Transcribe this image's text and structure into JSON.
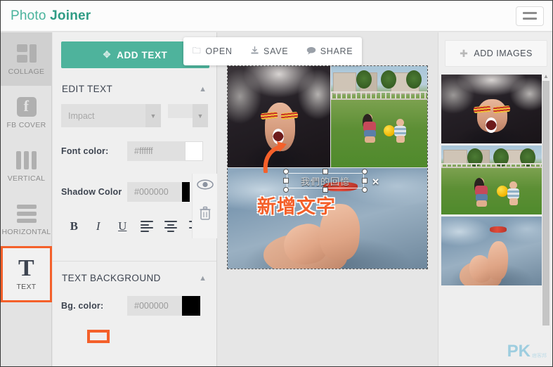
{
  "header": {
    "brand_light": "Photo ",
    "brand_bold": "Joiner",
    "menu_icon": "hamburger-icon"
  },
  "rail": {
    "items": [
      {
        "label": "COLLAGE",
        "icon": "collage-icon"
      },
      {
        "label": "FB COVER",
        "icon": "facebook-icon"
      },
      {
        "label": "VERTICAL",
        "icon": "vertical-columns-icon"
      },
      {
        "label": "HORIZONTAL",
        "icon": "horizontal-rows-icon"
      },
      {
        "label": "TEXT",
        "icon": "text-t-icon"
      }
    ]
  },
  "panel": {
    "add_text_button": "ADD TEXT",
    "add_text_icon": "move-arrows-icon",
    "edit_text": {
      "title": "EDIT TEXT",
      "collapse_icon": "caret-up-icon",
      "font_family_value": "Impact",
      "font_size_value": "",
      "font_color_label": "Font color:",
      "font_color_value": "#ffffff",
      "font_color_swatch": "#ffffff",
      "shadow_color_label": "Shadow Color",
      "shadow_color_value": "#000000",
      "shadow_color_swatch": "#000000",
      "format_buttons": [
        {
          "label": "B",
          "name": "bold-button"
        },
        {
          "label": "I",
          "name": "italic-button"
        },
        {
          "label": "U",
          "name": "underline-button"
        }
      ],
      "align_buttons": [
        {
          "name": "align-left-button"
        },
        {
          "name": "align-center-button"
        },
        {
          "name": "align-right-button"
        }
      ]
    },
    "text_background": {
      "title": "TEXT BACKGROUND",
      "collapse_icon": "caret-up-icon",
      "bg_color_label": "Bg. color:",
      "bg_color_value": "#000000",
      "bg_color_swatch": "#000000"
    },
    "tools": {
      "visibility_icon": "eye-icon",
      "delete_icon": "trash-icon"
    }
  },
  "float_menu": {
    "items": [
      {
        "label": "OPEN",
        "icon": "folder-icon"
      },
      {
        "label": "SAVE",
        "icon": "download-icon"
      },
      {
        "label": "SHARE",
        "icon": "speech-bubble-icon"
      }
    ]
  },
  "canvas": {
    "text_object_value": "我們的回憶",
    "text_delete_icon": "close-x-icon",
    "annotation_caption": "新增文字",
    "annotation_arrow_icon": "curved-arrow-icon",
    "carousel_next_icon": "chevron-right-icon",
    "photos": [
      {
        "name": "photo-scream-hair"
      },
      {
        "name": "photo-park-mother-child"
      },
      {
        "name": "photo-baby-feet"
      }
    ]
  },
  "right_panel": {
    "add_images_button": "ADD IMAGES",
    "add_images_icon": "plus-icon",
    "scroll_up_icon": "caret-up-icon",
    "thumbnails": [
      {
        "name": "thumbnail-scream-hair"
      },
      {
        "name": "thumbnail-park-mother-child"
      },
      {
        "name": "thumbnail-baby-feet"
      }
    ],
    "watermark_main": "PK",
    "watermark_sub": "痞客邦"
  },
  "colors": {
    "accent_green": "#4eb39c",
    "highlight_orange": "#f4602a",
    "panel_bg": "#efefef",
    "rail_bg": "#e3e3e3",
    "text_dark": "#3d4450"
  }
}
